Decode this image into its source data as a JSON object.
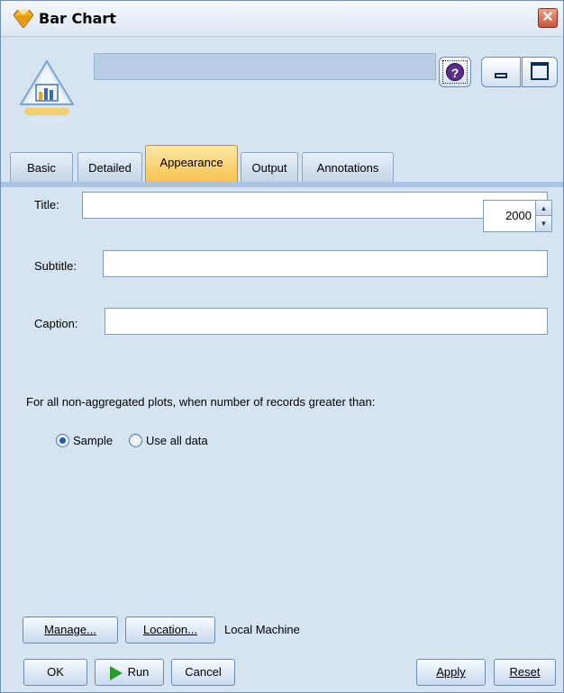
{
  "window": {
    "title": "Bar Chart"
  },
  "header": {
    "node_name": "",
    "help_label": "?"
  },
  "tabs": [
    {
      "label": "Basic"
    },
    {
      "label": "Detailed"
    },
    {
      "label": "Appearance"
    },
    {
      "label": "Output"
    },
    {
      "label": "Annotations"
    }
  ],
  "appearance": {
    "title_label": "Title:",
    "title_value": "",
    "subtitle_label": "Subtitle:",
    "subtitle_value": "",
    "caption_label": "Caption:",
    "caption_value": "",
    "records_label": "For all non-aggregated plots, when number of records greater than:",
    "records_value": "2000",
    "radio_sample": "Sample",
    "radio_all": "Use all data",
    "selected_radio": "Sample"
  },
  "footer": {
    "manage": "Manage...",
    "location": "Location...",
    "location_value": "Local Machine",
    "ok": "OK",
    "run": "Run",
    "cancel": "Cancel",
    "apply": "Apply",
    "reset": "Reset"
  },
  "colors": {
    "window_bg": "#d6e3f1",
    "active_tab": "#f7c24d",
    "run_icon": "#2f9a2a",
    "close_button": "#c9533a"
  }
}
